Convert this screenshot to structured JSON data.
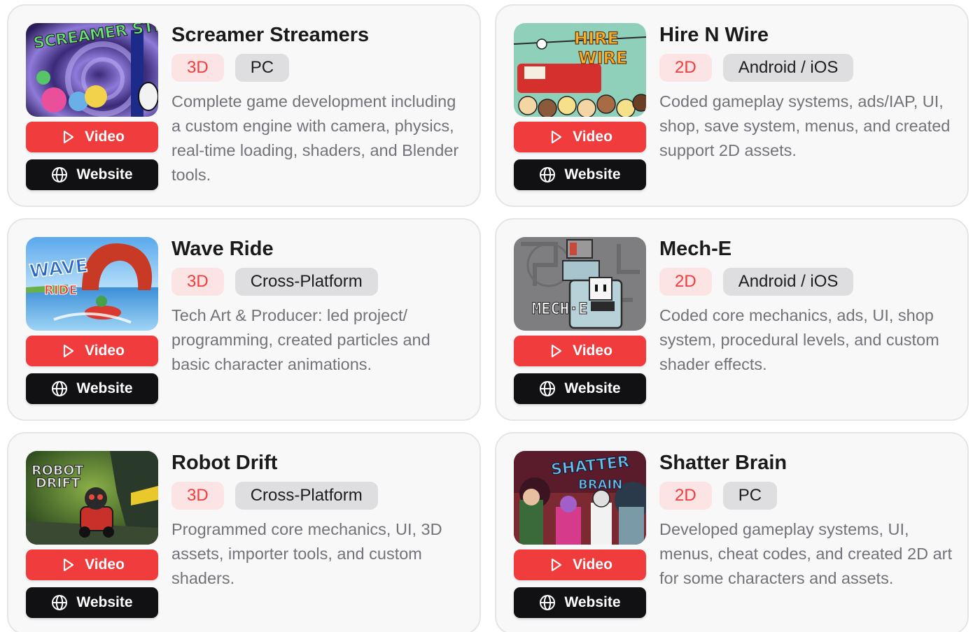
{
  "buttons": {
    "video_label": "Video",
    "website_label": "Website"
  },
  "projects": [
    {
      "title": "Screamer Streamers",
      "dimension": "3D",
      "platform": "PC",
      "description": "Complete game development including a custom engine with camera, physics, real-time loading, shaders, and Blender tools.",
      "thumbnail_text": "SCREAMER STREAMERS"
    },
    {
      "title": "Hire N Wire",
      "dimension": "2D",
      "platform": "Android / iOS",
      "description": "Coded gameplay systems, ads/IAP, UI, shop, save system, menus, and created support 2D assets.",
      "thumbnail_text": "HIRE N WIRE"
    },
    {
      "title": "Wave Ride",
      "dimension": "3D",
      "platform": "Cross-Platform",
      "description": "Tech Art & Producer: led project/ programming, created particles and basic character animations.",
      "thumbnail_text": "WAVE RIDE"
    },
    {
      "title": "Mech-E",
      "dimension": "2D",
      "platform": "Android / iOS",
      "description": "Coded core mechanics, ads, UI, shop system, procedural levels, and custom shader effects.",
      "thumbnail_text": "MECH·E"
    },
    {
      "title": "Robot Drift",
      "dimension": "3D",
      "platform": "Cross-Platform",
      "description": "Programmed core mechanics, UI, 3D assets, importer tools, and custom shaders.",
      "thumbnail_text": "ROBOT DRIFT"
    },
    {
      "title": "Shatter Brain",
      "dimension": "2D",
      "platform": "PC",
      "description": "Developed gameplay systems, UI, menus, cheat codes, and created 2D art for some characters and assets.",
      "thumbnail_text": "SHATTER BRAIN"
    }
  ],
  "icons": {
    "video": "play-icon",
    "website": "globe-icon"
  },
  "colors": {
    "video_button": "#f13c3e",
    "website_button": "#111113",
    "dimension_tag_text": "#f23c3e",
    "dimension_tag_bg": "#fde4e4",
    "platform_tag_bg": "#dedee0"
  }
}
